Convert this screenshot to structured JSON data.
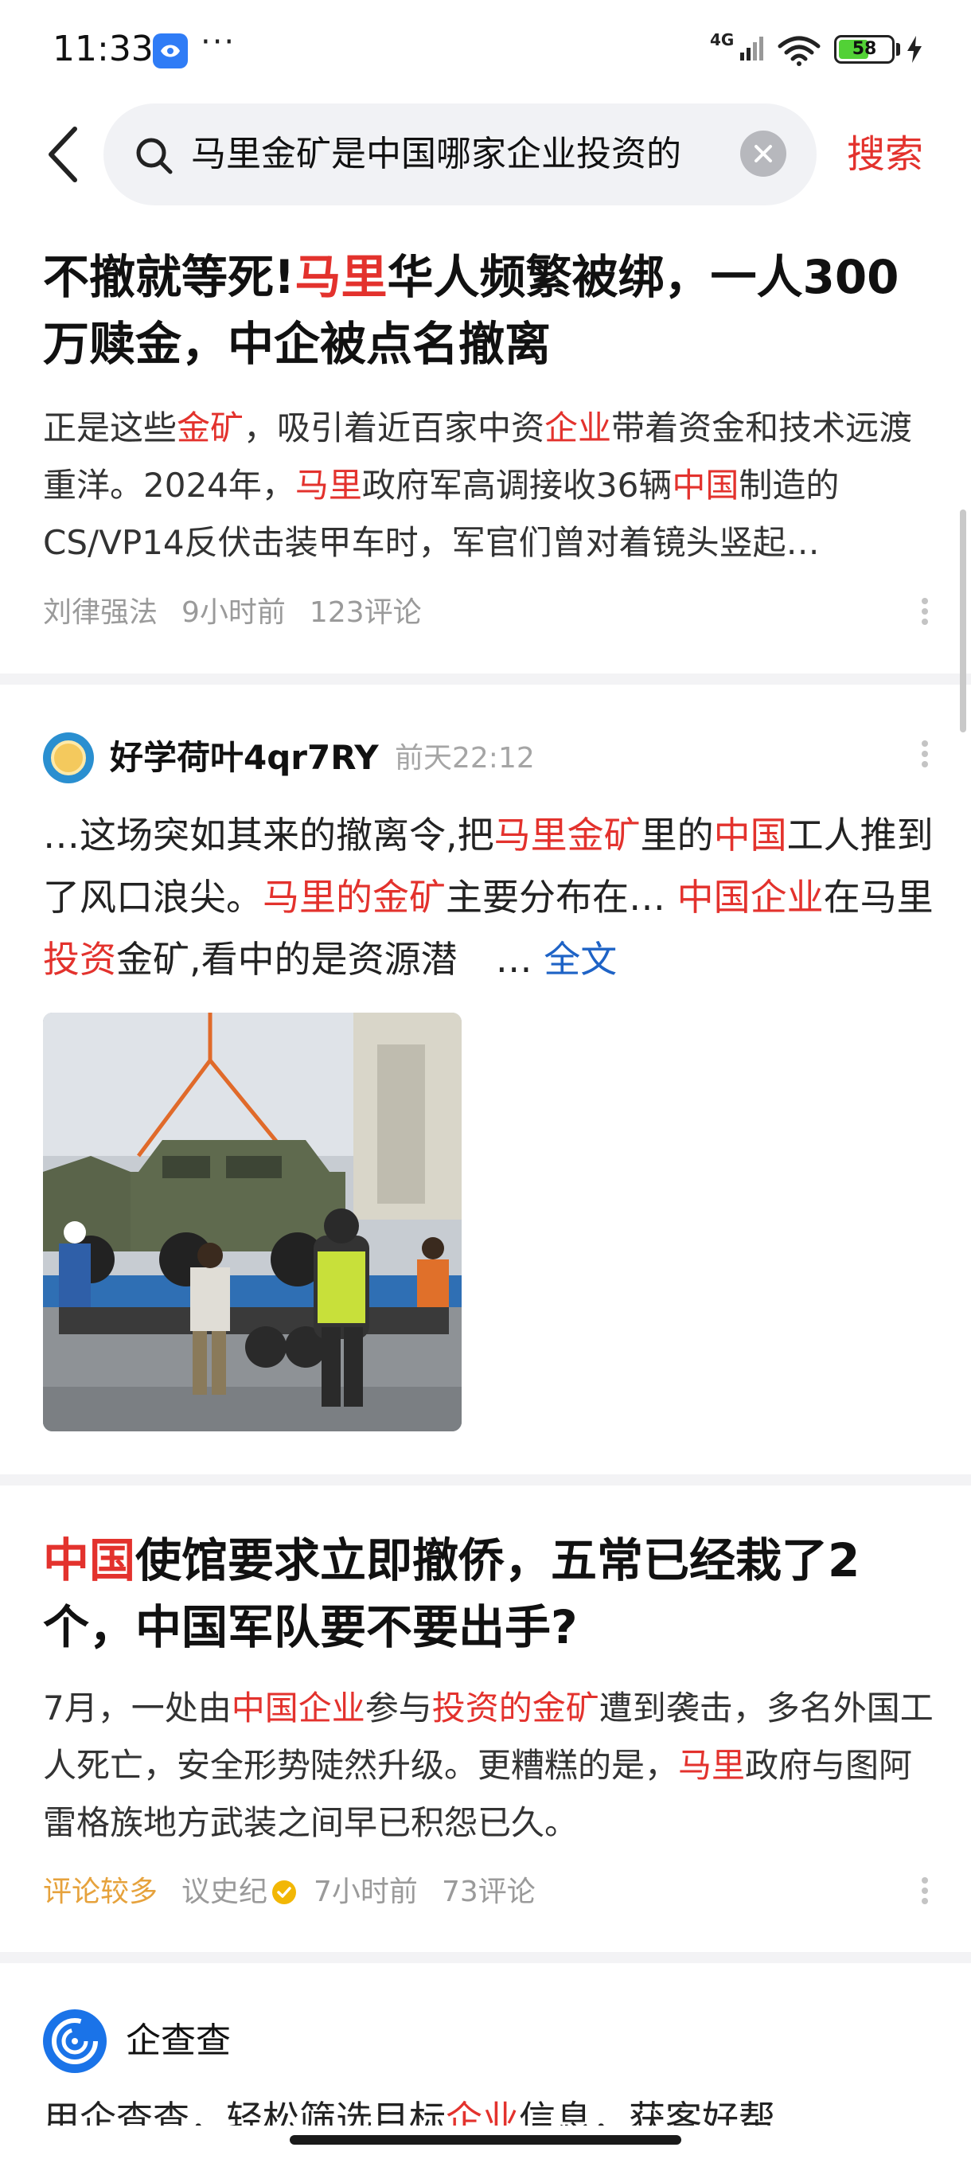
{
  "status_bar": {
    "time": "11:33",
    "dots": "···",
    "network": "4G",
    "battery": "58",
    "battery_level": 0.58
  },
  "search": {
    "query": "马里金矿是中国哪家企业投资的",
    "button": "搜索"
  },
  "article1": {
    "title_parts": [
      "不撤就等死!",
      "马里",
      "华人频繁被绑，一人300万赎金，中企被点名撤离"
    ],
    "summary_parts": [
      "正是这些",
      "金矿",
      "，吸引着近百家中资",
      "企业",
      "带着资金和技术远渡重洋。2024年，",
      "马里",
      "政府军高调接收36辆",
      "中国",
      "制造的CS/VP14反伏击装甲车时，军官们曾对着镜头竖起…"
    ],
    "source": "刘律强法",
    "time": "9小时前",
    "comments": "123评论"
  },
  "post": {
    "author": "好学荷叶4qr7RY",
    "time": "前天22:12",
    "text_parts": [
      "…这场突如其来的撤离令,把",
      "马里金矿",
      "里的",
      "中国",
      "工人推到了风口浪尖。",
      "马里的金矿",
      "主要分布在… ",
      "中国企业",
      "在马里",
      "投资",
      "金矿,看中的是资源潜"
    ],
    "ellipsis": "…",
    "fulltext": "全文"
  },
  "article2": {
    "title_parts": [
      "中国",
      "使馆要求立即撤侨，五常已经栽了2个，中国军队要不要出手?"
    ],
    "summary_parts": [
      "7月，一处由",
      "中国企业",
      "参与",
      "投资的金矿",
      "遭到袭击，多名外国工人死亡，安全形势陡然升级。更糟糕的是，",
      "马里",
      "政府与图阿雷格族地方武装之间早已积怨已久。"
    ],
    "tag": "评论较多",
    "source": "议史纪",
    "time": "7小时前",
    "comments": "73评论"
  },
  "ad": {
    "name": "企查查",
    "text_parts": [
      "用企查查，轻松筛选目标",
      "企业",
      "信息，获客好帮"
    ]
  },
  "colors": {
    "highlight": "#e3322d",
    "link": "#1e63c6",
    "tag": "#e6a23c",
    "meta": "#9a9a9a"
  }
}
